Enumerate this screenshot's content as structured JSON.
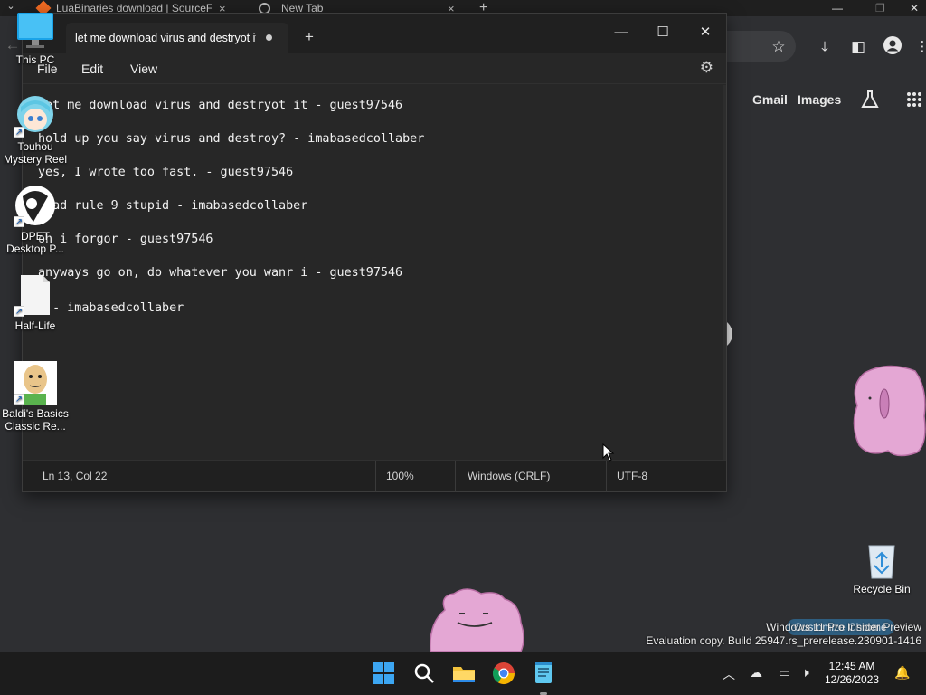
{
  "chrome": {
    "tabs": [
      {
        "label": "LuaBinaries download | SourceF",
        "close": "×"
      },
      {
        "label": "New Tab",
        "close": "×"
      }
    ],
    "new_tab_plus": "+",
    "header_links": {
      "gmail": "Gmail",
      "images": "Images"
    },
    "customize_label": "Customize Chrome"
  },
  "watermark": {
    "line1": "Windows 11 Pro Insider Preview",
    "line2": "Evaluation copy. Build 25947.rs_prerelease.230901-1416"
  },
  "notepad": {
    "tab_title": "let me download virus and destryot it",
    "new_tab_plus": "+",
    "controls": {
      "minimize": "—",
      "maximize": "☐",
      "close": "✕"
    },
    "menu": {
      "file": "File",
      "edit": "Edit",
      "view": "View"
    },
    "lines": [
      "let me download virus and destryot it - guest97546",
      "hold up you say virus and destroy? - imabasedcollaber",
      "yes, I wrote too fast. - guest97546",
      "read rule 9 stupid - imabasedcollaber",
      "oh i forgor - guest97546",
      "anyways go on, do whatever you wanr i - guest97546",
      "k - imabasedcollaber"
    ],
    "status": {
      "position": "Ln 13, Col 22",
      "zoom": "100%",
      "line_ending": "Windows (CRLF)",
      "encoding": "UTF-8"
    }
  },
  "desktop_icons": [
    {
      "label": "This PC"
    },
    {
      "label": "Touhou Mystery Reel"
    },
    {
      "label": "DPET Desktop P..."
    },
    {
      "label": "Half-Life"
    },
    {
      "label": "Baldi's Basics Classic Re..."
    },
    {
      "label": "Recycle Bin"
    }
  ],
  "taskbar": {
    "time": "12:45 AM",
    "date": "12/26/2023",
    "apps": [
      "start-icon",
      "search-icon",
      "file-explorer-icon",
      "chrome-icon",
      "notepad-icon"
    ]
  },
  "colors": {
    "taskbar": "#1c1c1c",
    "notepad_bg": "#272727",
    "chrome_bg": "#2e2f32",
    "ditto_pink": "#e4a7d4"
  }
}
